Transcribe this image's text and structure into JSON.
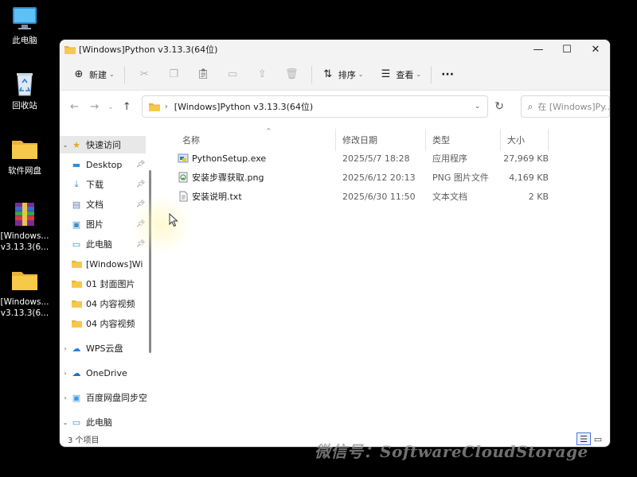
{
  "desktop": {
    "icons": [
      {
        "label": "此电脑",
        "icon": "monitor-icon"
      },
      {
        "label": "回收站",
        "icon": "recycle-bin-icon"
      },
      {
        "label": "软件网盘",
        "icon": "folder-icon"
      },
      {
        "label": "[Windows...",
        "label2": "v3.13.3(6...",
        "icon": "archive-icon"
      },
      {
        "label": "[Windows...",
        "label2": "v3.13.3(6...",
        "icon": "folder-icon"
      }
    ]
  },
  "window": {
    "title": "[Windows]Python v3.13.3(64位)",
    "controls": {
      "minimize": "—",
      "maximize": "☐",
      "close": "✕"
    }
  },
  "toolbar": {
    "new_label": "新建",
    "sort_label": "排序",
    "view_label": "查看",
    "more": "···"
  },
  "address": {
    "path": "[Windows]Python v3.13.3(64位)",
    "search_placeholder": "在 [Windows]Py..."
  },
  "nav": {
    "quick_access": "快速访问",
    "items": [
      {
        "label": "Desktop",
        "icon": "desktop-icon",
        "pinned": true
      },
      {
        "label": "下载",
        "icon": "download-icon",
        "pinned": true
      },
      {
        "label": "文档",
        "icon": "documents-icon",
        "pinned": true
      },
      {
        "label": "图片",
        "icon": "pictures-icon",
        "pinned": true
      },
      {
        "label": "此电脑",
        "icon": "monitor-icon",
        "pinned": true
      },
      {
        "label": "[Windows]Wi",
        "icon": "folder-icon",
        "pinned": false
      },
      {
        "label": "01 封面图片",
        "icon": "folder-icon",
        "pinned": false
      },
      {
        "label": "04 内容视频",
        "icon": "folder-icon",
        "pinned": false
      },
      {
        "label": "04 内容视频",
        "icon": "folder-icon",
        "pinned": false
      }
    ],
    "wps": "WPS云盘",
    "onedrive": "OneDrive",
    "baidu": "百度网盘同步空",
    "thispc": "此电脑"
  },
  "columns": {
    "name": "名称",
    "date": "修改日期",
    "type": "类型",
    "size": "大小"
  },
  "files": [
    {
      "name": "PythonSetup.exe",
      "date": "2025/5/7 18:28",
      "type": "应用程序",
      "size": "27,969 KB",
      "icon": "exe-icon"
    },
    {
      "name": "安装步骤获取.png",
      "date": "2025/6/12 20:13",
      "type": "PNG 图片文件",
      "size": "4,169 KB",
      "icon": "image-file-icon"
    },
    {
      "name": "安装说明.txt",
      "date": "2025/6/30 11:50",
      "type": "文本文档",
      "size": "2 KB",
      "icon": "text-file-icon"
    }
  ],
  "status": {
    "count": "3 个项目"
  },
  "watermark": "微信号：SoftwareCloudStorage"
}
